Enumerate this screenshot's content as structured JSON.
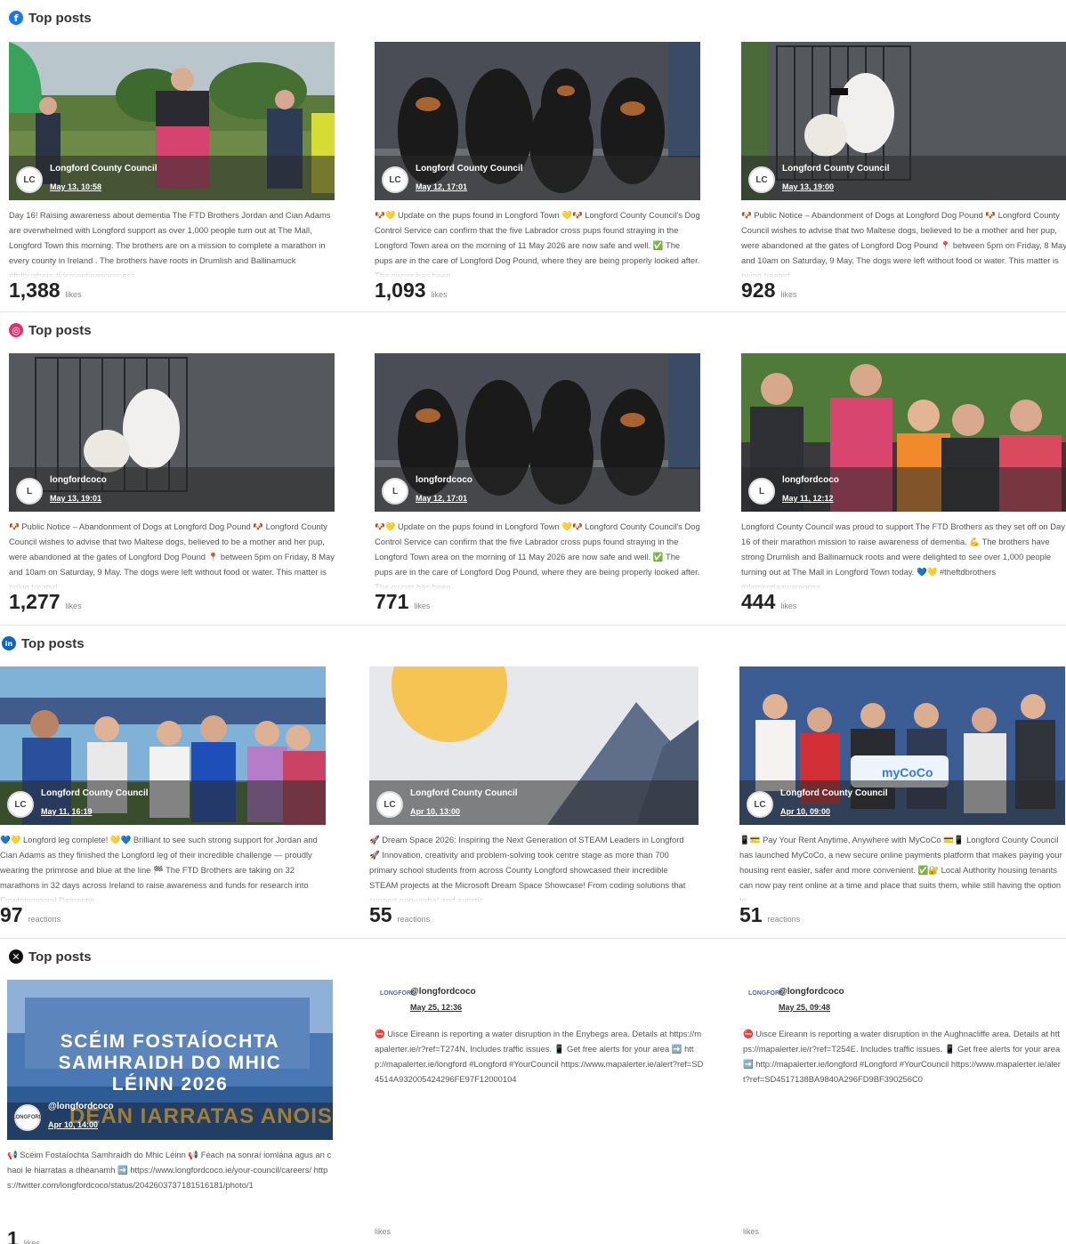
{
  "sections": [
    {
      "title": "Top posts",
      "platform": "facebook",
      "color": "#1877f2",
      "unit": "likes",
      "posts": [
        {
          "avatar": "LC",
          "author": "Longford County Council",
          "date": "May 13, 10:58",
          "value": "1,388",
          "caption": "Day 16! Raising awareness about dementia The FTD Brothers Jordan and Cian Adams are overwhelmed with Longford support as over 1,000 people turn out at The Mall, Longford Town this morning. The brothers are on a mission to complete a marathon in every county in Ireland . The brothers have roots in Drumlish and Ballinamuck #ftdbrothers #dementiaawareness"
        },
        {
          "avatar": "LC",
          "author": "Longford County Council",
          "date": "May 12, 17:01",
          "value": "1,093",
          "caption": "🐶💛 Update on the pups found in Longford Town 💛🐶 Longford County Council's Dog Control Service can confirm that the five Labrador cross pups found straying in the Longford Town area on the morning of 11 May 2026 are now safe and well. ✅ The pups are in the care of Longford Dog Pound, where they are being properly looked after. The owner has been"
        },
        {
          "avatar": "LC",
          "author": "Longford County Council",
          "date": "May 13, 19:00",
          "value": "928",
          "caption": "🐶 Public Notice – Abandonment of Dogs at Longford Dog Pound 🐶 Longford County Council wishes to advise that two Maltese dogs, believed to be a mother and her pup, were abandoned at the gates of Longford Dog Pound 📍 between 5pm on Friday, 8 May and 10am on Saturday, 9 May. The dogs were left without food or water. This matter is being treated"
        }
      ]
    },
    {
      "title": "Top posts",
      "platform": "instagram",
      "color": "#e1306c",
      "unit": "likes",
      "posts": [
        {
          "avatar": "L",
          "author": "longfordcoco",
          "date": "May 13, 19:01",
          "value": "1,277",
          "caption": "🐶 Public Notice – Abandonment of Dogs at Longford Dog Pound 🐶 Longford County Council wishes to advise that two Maltese dogs, believed to be a mother and her pup, were abandoned at the gates of Longford Dog Pound 📍 between 5pm on Friday, 8 May and 10am on Saturday, 9 May. The dogs were left without food or water. This matter is being treated"
        },
        {
          "avatar": "L",
          "author": "longfordcoco",
          "date": "May 12, 17:01",
          "value": "771",
          "caption": "🐶💛 Update on the pups found in Longford Town 💛🐶 Longford County Council's Dog Control Service can confirm that the five Labrador cross pups found straying in the Longford Town area on the morning of 11 May 2026 are now safe and well. ✅ The pups are in the care of Longford Dog Pound, where they are being properly looked after. The owner has been"
        },
        {
          "avatar": "L",
          "author": "longfordcoco",
          "date": "May 11, 12:12",
          "value": "444",
          "caption": "Longford County Council was proud to support The FTD Brothers as they set off on Day 16 of their marathon mission to raise awareness of dementia. 💪 The brothers have strong Drumlish and Ballinamuck roots and were delighted to see over 1,000 people turning out at The Mall in Longford Town today. 💙💛 #theftdbrothers #dementiaawareness"
        }
      ]
    },
    {
      "title": "Top posts",
      "platform": "linkedin",
      "color": "#0a66c2",
      "unit": "reactions",
      "posts": [
        {
          "avatar": "LC",
          "author": "Longford County Council",
          "date": "May 11, 16:19",
          "value": "97",
          "caption": "💙💛 Longford leg complete! 💛💙 Brilliant to see such strong support for Jordan and Cian Adams as they finished the Longford leg of their incredible challenge — proudly wearing the primrose and blue at the line 🏁 The FTD Brothers are taking on 32 marathons in 32 days across Ireland to raise awareness and funds for research into Frontotemporal Dementia"
        },
        {
          "avatar": "LC",
          "author": "Longford County Council",
          "date": "Apr 10, 13:00",
          "value": "55",
          "caption": "🚀 Dream Space 2026: Inspiring the Next Generation of STEAM Leaders in Longford 🚀 Innovation, creativity and problem-solving took centre stage as more than 700 primary school students from across County Longford showcased their incredible STEAM projects at the Microsoft Dream Space Showcase! From coding solutions that support non-verbal and autistic"
        },
        {
          "avatar": "LC",
          "author": "Longford County Council",
          "date": "Apr 10, 09:00",
          "value": "51",
          "caption": "📱💳 Pay Your Rent Anytime, Anywhere with MyCoCo 💳📱 Longford County Council has launched MyCoCo, a new secure online payments platform that makes paying your housing rent easier, safer and more convenient. ✅🔐 Local Authority housing tenants can now pay rent online at a time and place that suits them, while still having the option to"
        }
      ]
    },
    {
      "title": "Top posts",
      "platform": "x",
      "color": "#111111",
      "unit": "likes",
      "posts": [
        {
          "avatar": "",
          "author": "@longfordcoco",
          "date": "Apr 10, 14:00",
          "value": "1",
          "banner_lines": [
            "SCÉIM FOSTAÍOCHTA",
            "SAMHRAIDH DO MHIC",
            "LÉINN 2026"
          ],
          "banner_sub": "DÉAN IARRATAS ANOIS",
          "caption": "📢 Scéim Fostaíochta Samhraidh do Mhic Léinn 📢 Féach na sonraí iomlána agus an chaoi le hiarratas a dhéanamh ➡️ https://www.longfordcoco.ie/your-council/careers/ https://twitter.com/longfordcoco/status/2042603737181516181/photo/1"
        },
        {
          "avatar": "",
          "author": "@longfordcoco",
          "date": "May 25, 12:36",
          "value": "",
          "caption": "⛔ Uisce Eireann is reporting a water disruption in the Enybegs area. Details at https://mapalerter.ie/r?ref=T274N. Includes traffic issues. 📱 Get free alerts for your area ➡️ http://mapalerter.ie/longford #Longford #YourCouncil https://www.mapalerter.ie/alert?ref=SD4514A932005424296FE97F12000104"
        },
        {
          "avatar": "",
          "author": "@longfordcoco",
          "date": "May 25, 09:48",
          "value": "",
          "caption": "⛔ Uisce Eireann is reporting a water disruption in the Aughnacliffe area. Details at https://mapalerter.ie/r?ref=T254E. Includes traffic issues. 📱 Get free alerts for your area ➡️ http://mapalerter.ie/longford #Longford #YourCouncil https://www.mapalerter.ie/alert?ref=SD4517138BA9840A296FD9BF390256C0"
        }
      ]
    }
  ],
  "icons": {
    "facebook": "f",
    "instagram": "◎",
    "linkedin": "in",
    "x": "✕"
  },
  "x_logo_text": "LONGFORD"
}
